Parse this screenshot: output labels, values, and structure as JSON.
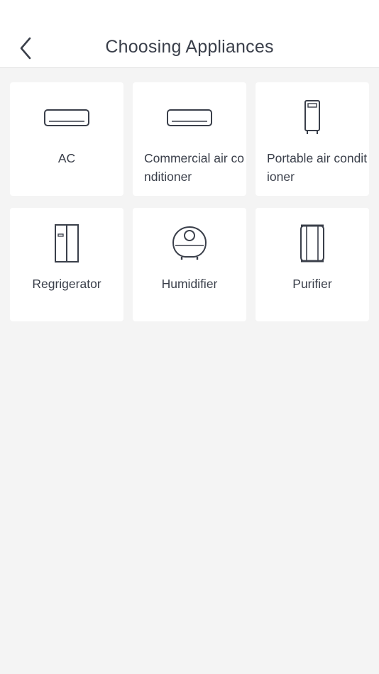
{
  "header": {
    "title": "Choosing Appliances",
    "back_icon": "chevron-left-icon"
  },
  "appliances": [
    {
      "label": "AC",
      "icon": "wall-ac-icon"
    },
    {
      "label": "Commercial air conditioner",
      "icon": "commercial-ac-icon"
    },
    {
      "label": "Portable air conditioner",
      "icon": "portable-ac-icon"
    },
    {
      "label": "Regrigerator",
      "icon": "refrigerator-icon"
    },
    {
      "label": "Humidifier",
      "icon": "humidifier-icon"
    },
    {
      "label": "Purifier",
      "icon": "purifier-icon"
    }
  ],
  "colors": {
    "background": "#f4f4f4",
    "card": "#ffffff",
    "text": "#3a3f4a",
    "icon_stroke": "#3a3f4a"
  }
}
